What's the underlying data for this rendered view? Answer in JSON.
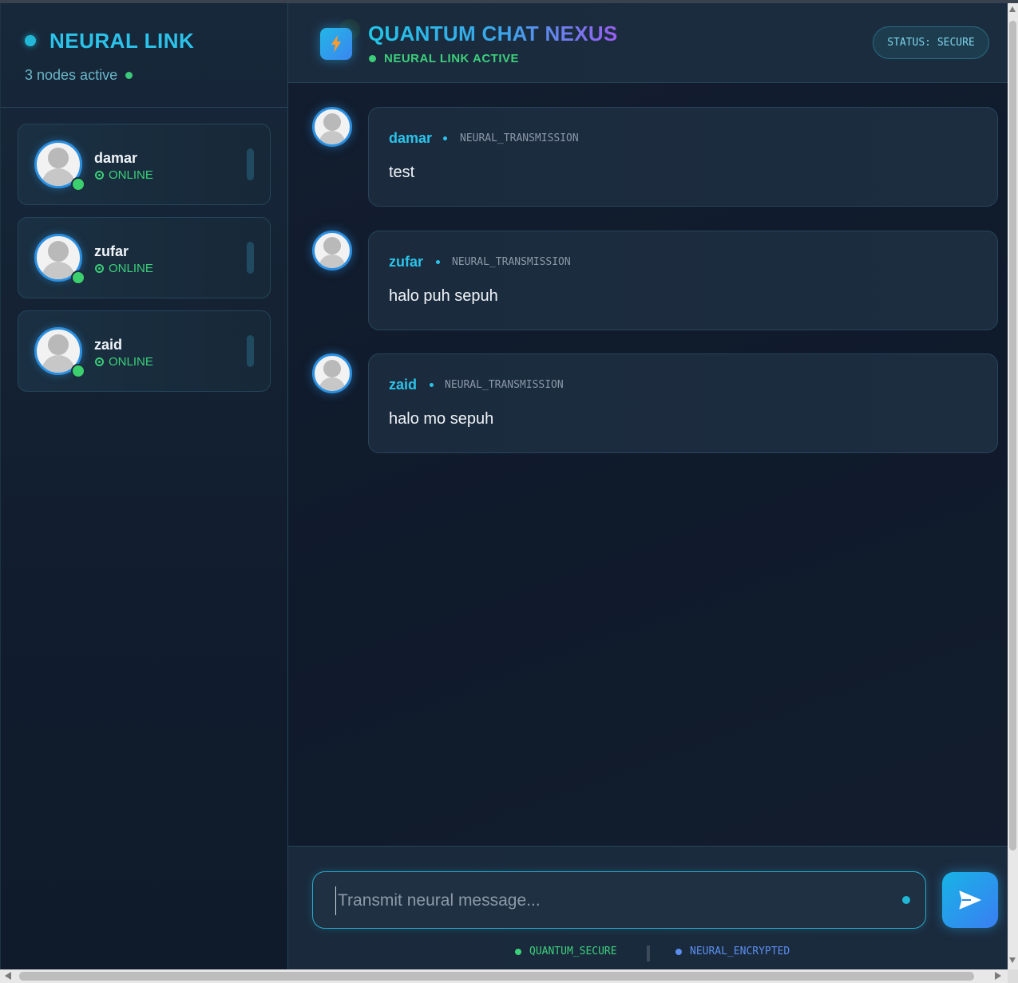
{
  "sidebar": {
    "title": "NEURAL LINK",
    "subtitle": "3 nodes active",
    "users": [
      {
        "name": "damar",
        "status": "ONLINE"
      },
      {
        "name": "zufar",
        "status": "ONLINE"
      },
      {
        "name": "zaid",
        "status": "ONLINE"
      }
    ]
  },
  "header": {
    "logo_icon": "lightning-bolt-icon",
    "title": "QUANTUM CHAT NEXUS",
    "link_status": "NEURAL LINK ACTIVE",
    "status_pill": "STATUS: SECURE"
  },
  "messages": [
    {
      "sender": "damar",
      "tag": "NEURAL_TRANSMISSION",
      "text": "test"
    },
    {
      "sender": "zufar",
      "tag": "NEURAL_TRANSMISSION",
      "text": "halo puh sepuh"
    },
    {
      "sender": "zaid",
      "tag": "NEURAL_TRANSMISSION",
      "text": "halo mo sepuh"
    }
  ],
  "composer": {
    "placeholder": "Transmit neural message...",
    "value": "",
    "send_icon": "send-icon"
  },
  "footer": {
    "left": "QUANTUM_SECURE",
    "right": "NEURAL_ENCRYPTED"
  },
  "colors": {
    "accent_cyan": "#2cc3ea",
    "online_green": "#3cd07a",
    "accent_purple": "#9a5cf0",
    "encrypted_blue": "#5a8ff0"
  }
}
